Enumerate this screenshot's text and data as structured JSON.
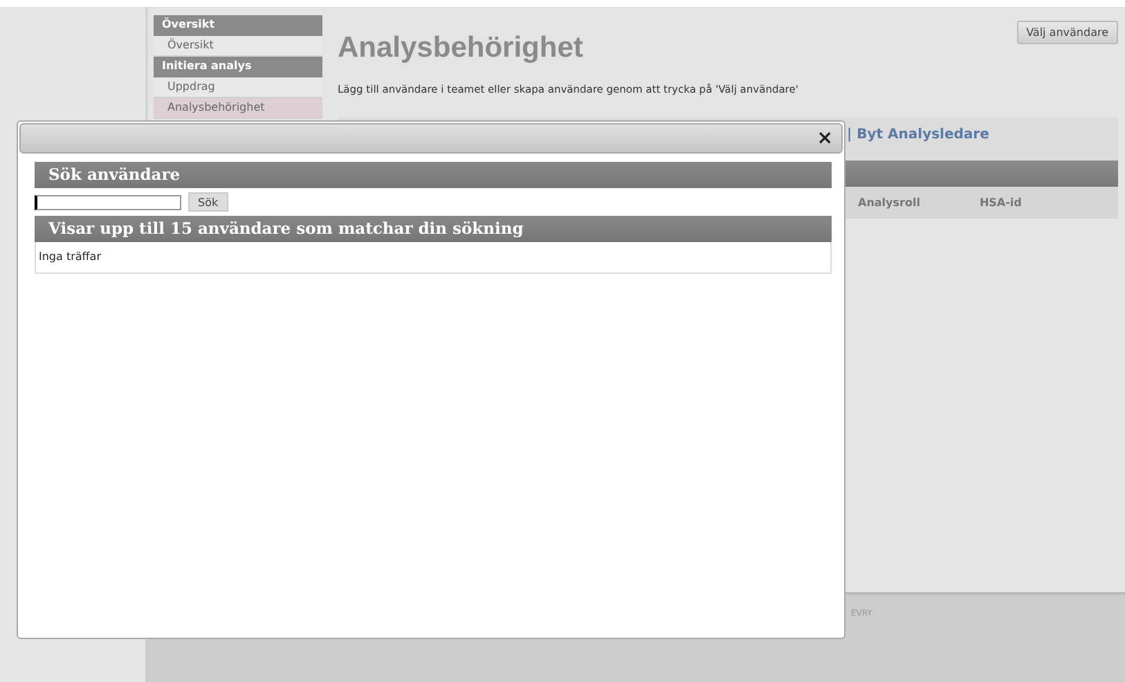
{
  "sidebar": {
    "sections": [
      {
        "title": "Översikt",
        "items": [
          {
            "label": "Översikt",
            "selected": false
          }
        ]
      },
      {
        "title": "Initiera analys",
        "items": [
          {
            "label": "Uppdrag",
            "selected": false
          },
          {
            "label": "Analysbehörighet",
            "selected": true
          }
        ]
      }
    ]
  },
  "page": {
    "title": "Analysbehörighet",
    "intro": "Lägg till användare i teamet eller skapa användare genom att trycka på 'Välj användare'",
    "select_button": "Välj användare",
    "link": "| Byt Analysledare",
    "table": {
      "columns": [
        "Analysroll",
        "HSA-id"
      ]
    }
  },
  "footer": {
    "text": "EVRY"
  },
  "dialog": {
    "close": "×",
    "search": {
      "heading": "Sök användare",
      "button": "Sök"
    },
    "results": {
      "heading": "Visar upp till 15 användare som matchar din sökning",
      "empty": "Inga träffar"
    }
  }
}
